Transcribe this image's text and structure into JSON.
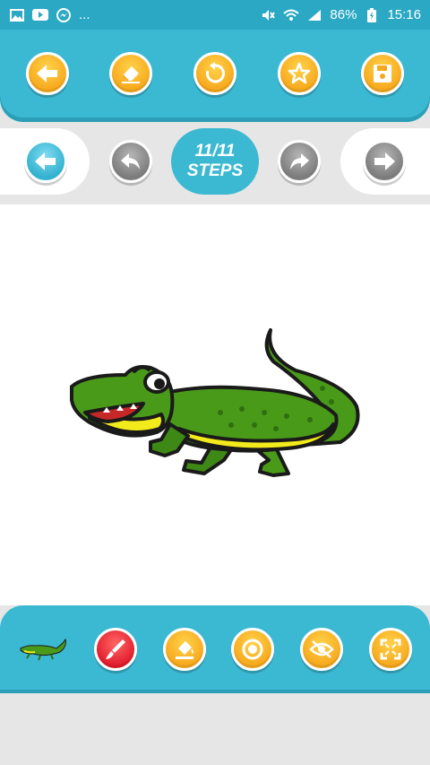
{
  "status_bar": {
    "left_icons": [
      "image-icon",
      "youtube-icon",
      "messenger-icon"
    ],
    "dots": "...",
    "battery": "86%",
    "time": "15:16"
  },
  "top_toolbar": {
    "buttons": [
      "back-icon",
      "eraser-icon",
      "reset-icon",
      "star-icon",
      "save-icon"
    ]
  },
  "steps": {
    "current": "11/11",
    "label": "STEPS"
  },
  "bottom_toolbar": {
    "buttons": [
      "thumbnail",
      "brush-icon",
      "fill-icon",
      "record-icon",
      "hide-icon",
      "fullscreen-icon"
    ]
  },
  "colors": {
    "accent": "#3bb8d2",
    "orange": "#f7a91d",
    "red": "#e21d2c",
    "croc_green": "#4a9a1a",
    "croc_yellow": "#f3ea1c"
  }
}
